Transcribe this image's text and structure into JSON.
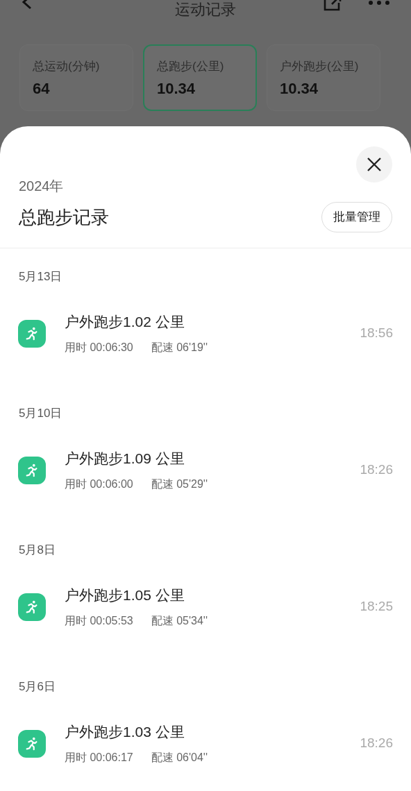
{
  "header": {
    "title": "运动记录"
  },
  "stats": [
    {
      "label": "总运动(分钟)",
      "value": "64",
      "selected": false
    },
    {
      "label": "总跑步(公里)",
      "value": "10.34",
      "selected": true
    },
    {
      "label": "户外跑步(公里)",
      "value": "10.34",
      "selected": false
    }
  ],
  "sheet": {
    "year": "2024年",
    "title": "总跑步记录",
    "batch_button": "批量管理"
  },
  "groups": [
    {
      "date": "5月13日",
      "records": [
        {
          "title": "户外跑步1.02 公里",
          "duration": "用时 00:06:30",
          "pace": "配速 06'19''",
          "time": "18:56"
        }
      ]
    },
    {
      "date": "5月10日",
      "records": [
        {
          "title": "户外跑步1.09 公里",
          "duration": "用时 00:06:00",
          "pace": "配速 05'29''",
          "time": "18:26"
        }
      ]
    },
    {
      "date": "5月8日",
      "records": [
        {
          "title": "户外跑步1.05 公里",
          "duration": "用时 00:05:53",
          "pace": "配速 05'34''",
          "time": "18:25"
        }
      ]
    },
    {
      "date": "5月6日",
      "records": [
        {
          "title": "户外跑步1.03 公里",
          "duration": "用时 00:06:17",
          "pace": "配速 06'04''",
          "time": "18:26"
        }
      ]
    }
  ]
}
